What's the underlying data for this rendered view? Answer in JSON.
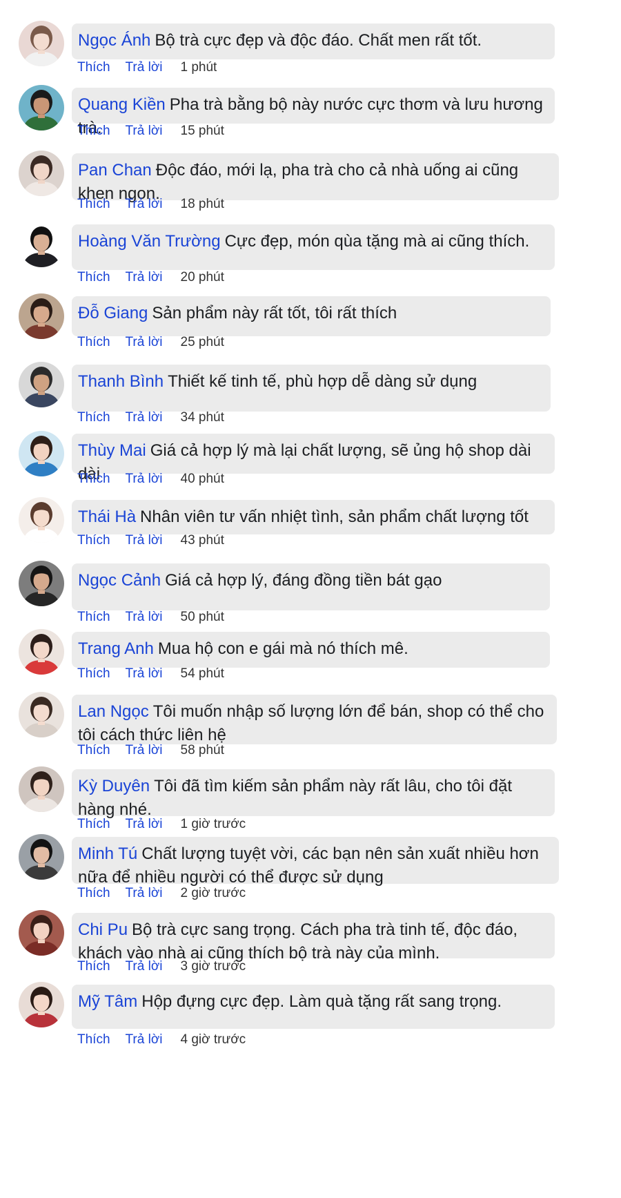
{
  "labels": {
    "like": "Thích",
    "reply": "Trả lời"
  },
  "comments": [
    {
      "author": "Ngọc Ánh",
      "text": "Bộ trà cực đẹp và độc đáo. Chất men rất tốt.",
      "time": "1 phút",
      "avatar_colors": {
        "bg": "#e9d8d4",
        "hair": "#7a5a4a",
        "skin": "#f3dcd0",
        "shirt": "#f1f1f1"
      }
    },
    {
      "author": "Quang Kiền",
      "text": "Pha trà bằng bộ này nước cực thơm và lưu hương trà.",
      "time": "15 phút",
      "avatar_colors": {
        "bg": "#6fb3c9",
        "hair": "#1a1a1a",
        "skin": "#c99676",
        "shirt": "#2f6f3a"
      }
    },
    {
      "author": "Pan Chan",
      "text": "Độc đáo, mới lạ, pha trà cho cả nhà uống ai cũng khen ngon.",
      "time": "18 phút",
      "avatar_colors": {
        "bg": "#dcd3ce",
        "hair": "#3b2a24",
        "skin": "#f0d6c8",
        "shirt": "#efe8e4"
      }
    },
    {
      "author": "Hoàng Văn Trường",
      "text": "Cực đẹp, món qùa tặng mà ai cũng thích.",
      "time": "20 phút",
      "avatar_colors": {
        "bg": "#ffffff",
        "hair": "#111111",
        "skin": "#d9b095",
        "shirt": "#1f1f24"
      }
    },
    {
      "author": "Đỗ Giang",
      "text": "Sản phẩm này rất tốt, tôi rất thích",
      "time": "25 phút",
      "avatar_colors": {
        "bg": "#bca58f",
        "hair": "#2a1c16",
        "skin": "#d7a98c",
        "shirt": "#7a3a2e"
      }
    },
    {
      "author": "Thanh Bình",
      "text": "Thiết kế tinh tế, phù hợp dễ dàng sử dụng",
      "time": "34 phút",
      "avatar_colors": {
        "bg": "#d8d8d8",
        "hair": "#2b2b2b",
        "skin": "#cfa282",
        "shirt": "#3a4660"
      }
    },
    {
      "author": "Thùy Mai",
      "text": "Giá cả hợp lý mà lại chất lượng, sẽ ủng hộ shop dài dài",
      "time": "40 phút",
      "avatar_colors": {
        "bg": "#cfe6f2",
        "hair": "#2e1f18",
        "skin": "#f2d3c1",
        "shirt": "#2f7fc4"
      }
    },
    {
      "author": "Thái Hà",
      "text": "Nhân viên tư vấn nhiệt tình, sản phẩm chất lượng tốt",
      "time": "43 phút",
      "avatar_colors": {
        "bg": "#f4eeea",
        "hair": "#5a3c2e",
        "skin": "#f5dccd",
        "shirt": "#ffffff"
      }
    },
    {
      "author": "Ngọc Cảnh",
      "text": "Giá cả hợp lý, đáng đồng tiền bát gạo",
      "time": "50 phút",
      "avatar_colors": {
        "bg": "#7d7d7d",
        "hair": "#151515",
        "skin": "#d5a98d",
        "shirt": "#262626"
      }
    },
    {
      "author": "Trang Anh",
      "text": "Mua hộ con e gái mà nó thích mê.",
      "time": "54 phút",
      "avatar_colors": {
        "bg": "#ece4df",
        "hair": "#2c1e1a",
        "skin": "#f3d8ca",
        "shirt": "#d93a3a"
      }
    },
    {
      "author": "Lan Ngọc",
      "text": "Tôi muốn nhập số lượng lớn để bán, shop có thể cho tôi cách thức liên hệ",
      "time": "58 phút",
      "avatar_colors": {
        "bg": "#e9e2dd",
        "hair": "#3a2a22",
        "skin": "#f4dccf",
        "shirt": "#d8cfc8"
      }
    },
    {
      "author": "Kỳ Duyên",
      "text": "Tôi đã tìm kiếm sản phẩm này rất lâu, cho tôi đặt hàng nhé.",
      "time": "1 giờ trước",
      "avatar_colors": {
        "bg": "#cfc5bf",
        "hair": "#2f211b",
        "skin": "#f1d4c3",
        "shirt": "#ece6e2"
      }
    },
    {
      "author": "Minh Tú",
      "text": "Chất lượng tuyệt vời, các bạn nên sản xuất nhiều hơn nữa để nhiều người có thể được sử dụng",
      "time": "2 giờ trước",
      "avatar_colors": {
        "bg": "#9aa0a6",
        "hair": "#121212",
        "skin": "#e2bca4",
        "shirt": "#3b3b3b"
      }
    },
    {
      "author": "Chi Pu",
      "text": "Bộ trà cực sang trọng. Cách pha trà tinh tế, độc đáo, khách vào nhà ai cũng thích bộ trà này của mình.",
      "time": "3 giờ trước",
      "avatar_colors": {
        "bg": "#a35a4e",
        "hair": "#3a1f18",
        "skin": "#f2d2c2",
        "shirt": "#7a2c26"
      }
    },
    {
      "author": "Mỹ Tâm",
      "text": "Hộp đựng cực đẹp. Làm quà tặng rất sang trọng.",
      "time": "4 giờ trước",
      "avatar_colors": {
        "bg": "#e8dcd6",
        "hair": "#2a1b15",
        "skin": "#f4d7c8",
        "shirt": "#b8323a"
      }
    }
  ]
}
